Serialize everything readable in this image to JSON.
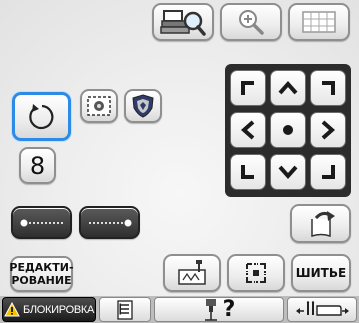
{
  "top_toolbar": {
    "icons": [
      "embroidery-frame-search-icon",
      "zoom-in-icon",
      "grid-icon"
    ]
  },
  "edit_tools": {
    "rotate_icon": "rotate-icon",
    "pattern_select_icon": "pattern-select-icon",
    "shield_icon": "shield-icon",
    "sequence_label": "8"
  },
  "arrow_pad": {
    "icons": [
      "corner-up-left-icon",
      "arrow-up-icon",
      "corner-up-right-icon",
      "arrow-left-icon",
      "center-dot-icon",
      "arrow-right-icon",
      "corner-down-left-icon",
      "arrow-down-icon",
      "corner-down-right-icon"
    ]
  },
  "action_buttons": {
    "edit_label_line1": "РЕДАКТИ-",
    "edit_label_line2": "РОВАНИЕ",
    "sew_label": "ШИТЬЕ"
  },
  "bottom_bar": {
    "lock_label": "БЛОКИРОВКА",
    "help_label": "?",
    "icons": [
      "warning-icon",
      "document-icon",
      "needle-icon",
      "presser-foot-icon"
    ]
  },
  "colors": {
    "selected_border": "#2c8be6",
    "arrow_pad_background": "#2c2c2c",
    "bottom_bar_background": "#bdbdbd",
    "warning_yellow": "#f2c200"
  }
}
